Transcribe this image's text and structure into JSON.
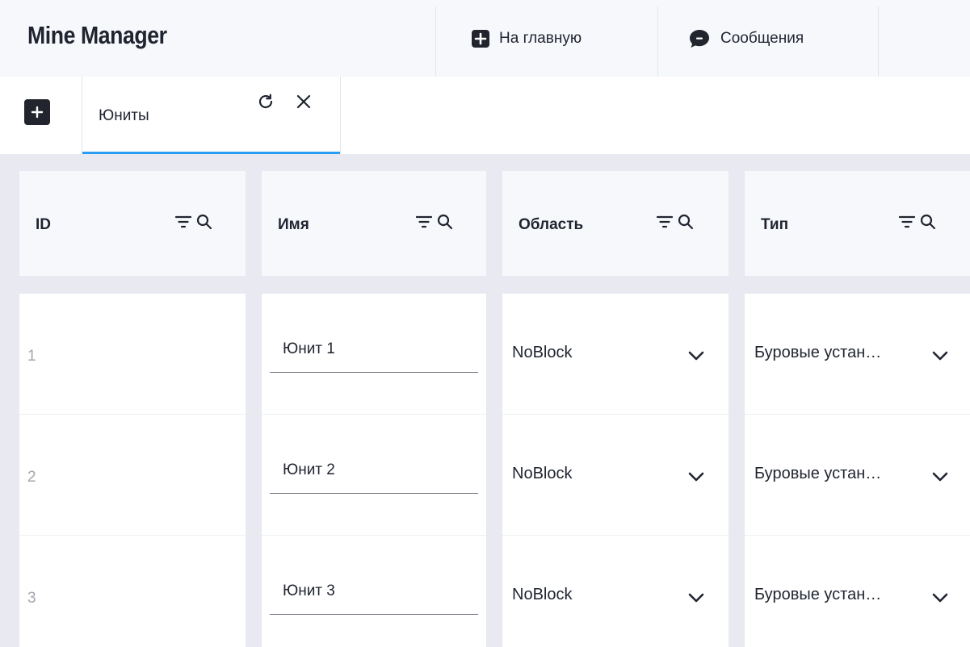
{
  "app": {
    "title": "Mine Manager"
  },
  "nav": {
    "home_label": "На главную",
    "messages_label": "Сообщения"
  },
  "tabs": [
    {
      "label": "Юниты",
      "active": true
    }
  ],
  "table": {
    "columns": [
      {
        "key": "id",
        "label": "ID"
      },
      {
        "key": "name",
        "label": "Имя"
      },
      {
        "key": "area",
        "label": "Область"
      },
      {
        "key": "type",
        "label": "Тип"
      }
    ],
    "rows": [
      {
        "id": "1",
        "name": "Юнит 1",
        "area": "NoBlock",
        "type": "Буровые устан…"
      },
      {
        "id": "2",
        "name": "Юнит 2",
        "area": "NoBlock",
        "type": "Буровые устан…"
      },
      {
        "id": "3",
        "name": "Юнит 3",
        "area": "NoBlock",
        "type": "Буровые устан…"
      }
    ]
  },
  "colors": {
    "accent": "#2a9df4",
    "dark": "#22252e",
    "grid_gap": "#e8e9f1",
    "header_bg": "#f7f8fc"
  },
  "icons": {
    "home": "plus-square-icon",
    "messages": "chat-bubble-icon",
    "add_tab": "plus-icon",
    "refresh": "refresh-icon",
    "close": "close-icon",
    "filter": "filter-icon",
    "search": "search-icon",
    "dropdown": "chevron-down-icon"
  }
}
